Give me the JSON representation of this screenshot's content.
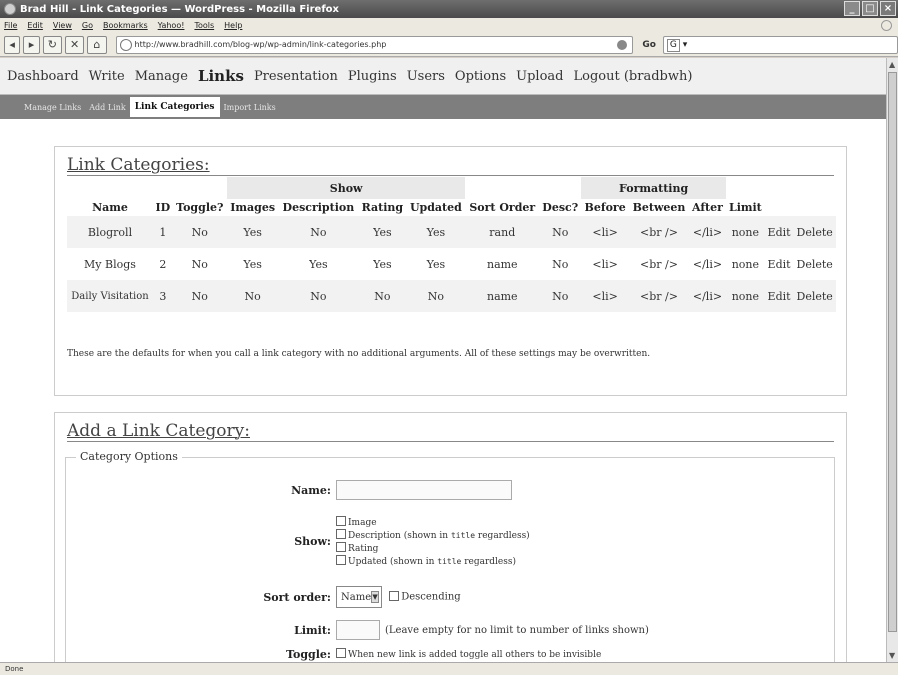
{
  "window": {
    "title": "Brad Hill - Link Categories — WordPress - Mozilla Firefox",
    "controls": [
      "_",
      "□",
      "×"
    ]
  },
  "menubar": [
    "File",
    "Edit",
    "View",
    "Go",
    "Bookmarks",
    "Yahoo!",
    "Tools",
    "Help"
  ],
  "navbar": {
    "url": "http://www.bradhill.com/blog-wp/wp-admin/link-categories.php",
    "go_label": "Go",
    "search_engine": "G"
  },
  "admin_menu": [
    "Dashboard",
    "Write",
    "Manage",
    "Links",
    "Presentation",
    "Plugins",
    "Users",
    "Options",
    "Upload",
    "Logout (bradbwh)"
  ],
  "submenu": [
    "Manage Links",
    "Add Link",
    "Link Categories",
    "Import Links"
  ],
  "link_categories": {
    "heading": "Link Categories:",
    "group_headers": {
      "show": "Show",
      "formatting": "Formatting"
    },
    "columns": [
      "Name",
      "ID",
      "Toggle?",
      "Images",
      "Description",
      "Rating",
      "Updated",
      "Sort Order",
      "Desc?",
      "Before",
      "Between",
      "After",
      "Limit"
    ],
    "rows": [
      {
        "name": "Blogroll",
        "id": "1",
        "toggle": "No",
        "images": "Yes",
        "description": "No",
        "rating": "Yes",
        "updated": "Yes",
        "sort": "rand",
        "desc": "No",
        "before": "<li>",
        "between": "<br />",
        "after": "</li>",
        "limit": "none",
        "edit": "Edit",
        "delete": "Delete"
      },
      {
        "name": "My Blogs",
        "id": "2",
        "toggle": "No",
        "images": "Yes",
        "description": "Yes",
        "rating": "Yes",
        "updated": "Yes",
        "sort": "name",
        "desc": "No",
        "before": "<li>",
        "between": "<br />",
        "after": "</li>",
        "limit": "none",
        "edit": "Edit",
        "delete": "Delete"
      },
      {
        "name": "Daily Visitation",
        "id": "3",
        "toggle": "No",
        "images": "No",
        "description": "No",
        "rating": "No",
        "updated": "No",
        "sort": "name",
        "desc": "No",
        "before": "<li>",
        "between": "<br />",
        "after": "</li>",
        "limit": "none",
        "edit": "Edit",
        "delete": "Delete"
      }
    ],
    "note": "These are the defaults for when you call a link category with no additional arguments. All of these settings may be overwritten."
  },
  "add_category": {
    "heading": "Add a Link Category:",
    "legend": "Category Options",
    "name_label": "Name:",
    "name_value": "",
    "show_label": "Show:",
    "show_options": {
      "image": "Image",
      "description_pre": "Description (shown in ",
      "description_code": "title",
      "description_post": " regardless)",
      "rating": "Rating",
      "updated_pre": "Updated (shown in ",
      "updated_code": "title",
      "updated_post": " regardless)"
    },
    "sort_label": "Sort order:",
    "sort_value": "Name",
    "descending_label": "Descending",
    "limit_label": "Limit:",
    "limit_hint": "(Leave empty for no limit to number of links shown)",
    "toggle_label": "Toggle:",
    "toggle_text": "When new link is added toggle all others to be invisible"
  },
  "status": "Done"
}
